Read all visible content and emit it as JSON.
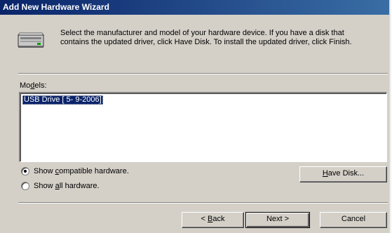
{
  "window": {
    "title": "Add New Hardware Wizard"
  },
  "icons": {
    "header": "hardware-device-icon"
  },
  "header": {
    "description": "Select the manufacturer and model of your hardware device. If you have a disk that contains the updated driver, click Have Disk. To install the updated driver, click Finish."
  },
  "models": {
    "label_pre": "Mo",
    "label_u": "d",
    "label_post": "els:",
    "items": [
      "USB Drive [ 5- 9-2006]"
    ],
    "selected_index": 0
  },
  "options": {
    "compatible": {
      "pre": "Show ",
      "u": "c",
      "post": "ompatible hardware.",
      "checked": true
    },
    "all": {
      "pre": "Show ",
      "u": "a",
      "post": "ll hardware.",
      "checked": false
    }
  },
  "buttons": {
    "have_disk": {
      "u": "H",
      "post": "ave Disk..."
    },
    "back": {
      "pre": "< ",
      "u": "B",
      "post": "ack"
    },
    "next": "Next >",
    "cancel": "Cancel"
  }
}
